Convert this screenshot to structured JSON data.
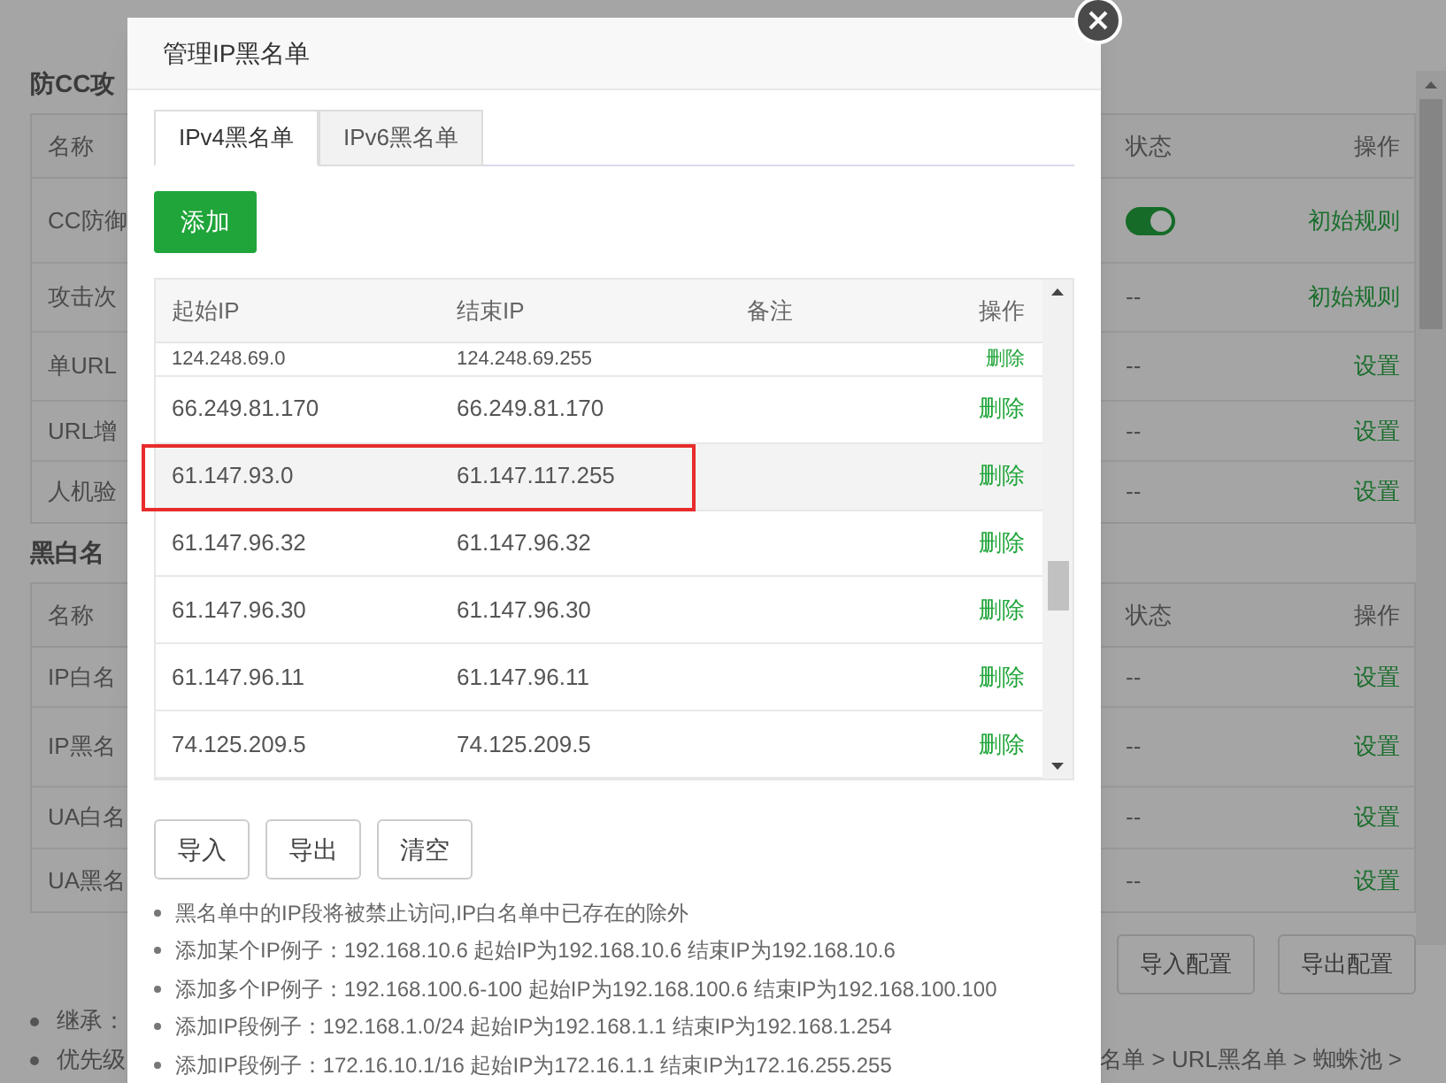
{
  "background": {
    "sections": [
      {
        "title": "防CC攻",
        "columns": [
          "名称",
          "状态",
          "操作"
        ],
        "rows": [
          {
            "name": "CC防御",
            "status": {
              "kind": "toggle",
              "on": true
            },
            "action": "初始规则"
          },
          {
            "name": "攻击次",
            "status": {
              "kind": "text",
              "text": "--"
            },
            "action": "初始规则"
          },
          {
            "name": "单URL",
            "status": {
              "kind": "text",
              "text": "--"
            },
            "action": "设置"
          },
          {
            "name": "URL增",
            "status": {
              "kind": "text",
              "text": "--"
            },
            "action": "设置"
          },
          {
            "name": "人机验",
            "status": {
              "kind": "text",
              "text": "--"
            },
            "action": "设置"
          }
        ]
      },
      {
        "title": "黑白名",
        "columns": [
          "名称",
          "状态",
          "操作"
        ],
        "rows": [
          {
            "name": "IP白名",
            "status": {
              "kind": "text",
              "text": "--"
            },
            "action": "设置"
          },
          {
            "name": "IP黑名",
            "status": {
              "kind": "text",
              "text": "--"
            },
            "action": "设置"
          },
          {
            "name": "UA白名",
            "status": {
              "kind": "text",
              "text": "--"
            },
            "action": "设置"
          },
          {
            "name": "UA黑名",
            "status": {
              "kind": "text",
              "text": "--"
            },
            "action": "设置"
          }
        ]
      }
    ],
    "buttons": [
      "导入配置",
      "导出配置"
    ],
    "notes": [
      "继承：",
      "优先级"
    ],
    "breadcrumb": "名单 > URL黑名单 > 蜘蛛池 >"
  },
  "modal": {
    "title": "管理IP黑名单",
    "tabs": [
      {
        "label": "IPv4黑名单",
        "selected": true
      },
      {
        "label": "IPv6黑名单",
        "selected": false
      }
    ],
    "add_button": "添加",
    "table": {
      "columns": [
        "起始IP",
        "结束IP",
        "备注",
        "操作"
      ],
      "rows": [
        {
          "start": "124.248.69.0",
          "end": "124.248.69.255",
          "action": "删除",
          "highlighted": false,
          "partial": true
        },
        {
          "start": "66.249.81.170",
          "end": "66.249.81.170",
          "action": "删除",
          "highlighted": false,
          "partial": false
        },
        {
          "start": "61.147.93.0",
          "end": "61.147.117.255",
          "action": "删除",
          "highlighted": true,
          "partial": false
        },
        {
          "start": "61.147.96.32",
          "end": "61.147.96.32",
          "action": "删除",
          "highlighted": false,
          "partial": false
        },
        {
          "start": "61.147.96.30",
          "end": "61.147.96.30",
          "action": "删除",
          "highlighted": false,
          "partial": false
        },
        {
          "start": "61.147.96.11",
          "end": "61.147.96.11",
          "action": "删除",
          "highlighted": false,
          "partial": false
        },
        {
          "start": "74.125.209.5",
          "end": "74.125.209.5",
          "action": "删除",
          "highlighted": false,
          "partial": false
        }
      ]
    },
    "buttons": [
      "导入",
      "导出",
      "清空"
    ],
    "tips": [
      "黑名单中的IP段将被禁止访问,IP白名单中已存在的除外",
      "添加某个IP例子：192.168.10.6 起始IP为192.168.10.6 结束IP为192.168.10.6",
      "添加多个IP例子：192.168.100.6-100 起始IP为192.168.100.6 结束IP为192.168.100.100",
      "添加IP段例子：192.168.1.0/24 起始IP为192.168.1.1 结束IP为192.168.1.254",
      "添加IP段例子：172.16.10.1/16 起始IP为172.16.1.1 结束IP为172.16.255.255"
    ]
  }
}
